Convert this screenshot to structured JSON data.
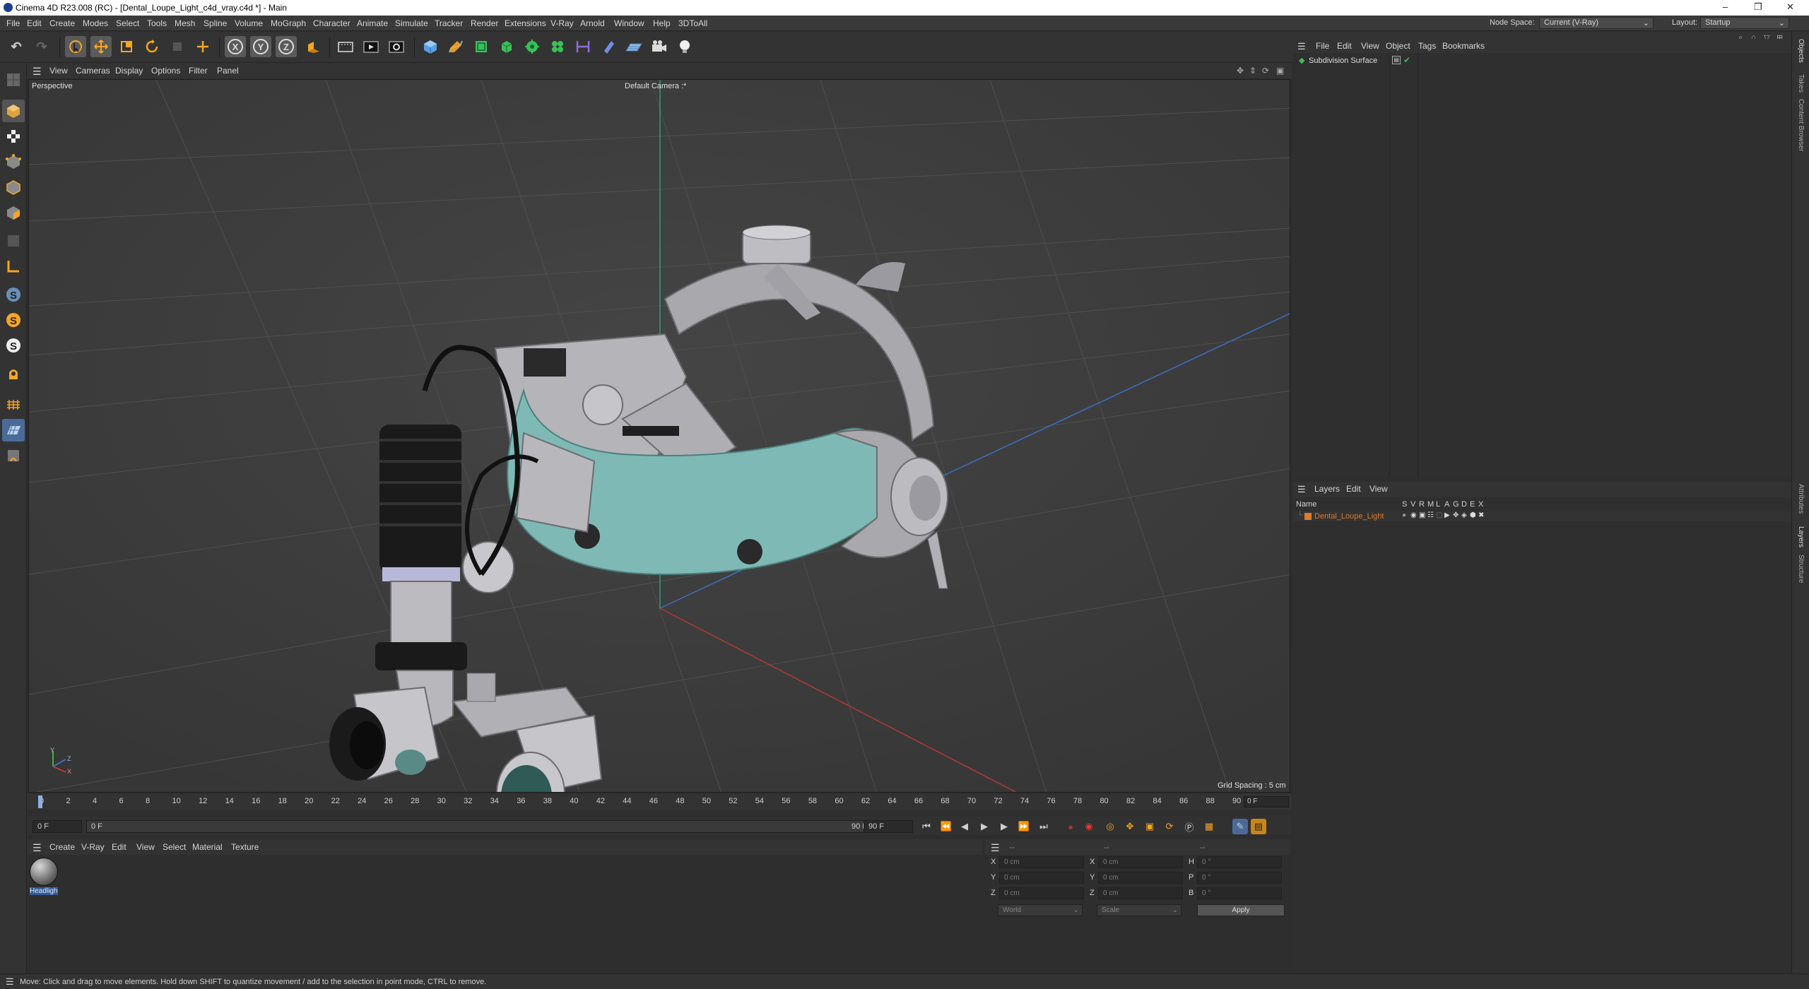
{
  "window": {
    "title": "Cinema 4D R23.008 (RC) - [Dental_Loupe_Light_c4d_vray.c4d *] - Main",
    "controls": [
      "–",
      "❐",
      "✕"
    ]
  },
  "menubar": {
    "items": [
      "File",
      "Edit",
      "Create",
      "Modes",
      "Select",
      "Tools",
      "Mesh",
      "Spline",
      "Volume",
      "MoGraph",
      "Character",
      "Animate",
      "Simulate",
      "Tracker",
      "Render",
      "Extensions",
      "V-Ray",
      "Arnold",
      "Window",
      "Help",
      "3DToAll"
    ],
    "node_space_label": "Node Space:",
    "node_space_value": "Current (V-Ray)",
    "layout_label": "Layout:",
    "layout_value": "Startup"
  },
  "toolbar": {
    "axis_x": "X",
    "axis_y": "Y",
    "axis_z": "Z"
  },
  "viewport": {
    "menu": [
      "View",
      "Cameras",
      "Display",
      "Options",
      "Filter",
      "Panel"
    ],
    "view_name": "Perspective",
    "camera": "Default Camera :*",
    "grid_spacing": "Grid Spacing : 5 cm",
    "axis_labels": [
      "Y",
      "Z",
      "X"
    ]
  },
  "timeline": {
    "ticks": [
      "0",
      "2",
      "4",
      "6",
      "8",
      "10",
      "12",
      "14",
      "16",
      "18",
      "20",
      "22",
      "24",
      "26",
      "28",
      "30",
      "32",
      "34",
      "36",
      "38",
      "40",
      "42",
      "44",
      "46",
      "48",
      "50",
      "52",
      "54",
      "56",
      "58",
      "60",
      "62",
      "64",
      "66",
      "68",
      "70",
      "72",
      "74",
      "76",
      "78",
      "80",
      "82",
      "84",
      "86",
      "88",
      "90"
    ],
    "current_frame_right": "0 F",
    "start_field": "0 F",
    "preview_start": "0 F",
    "preview_end": "90 F",
    "end_field": "90 F"
  },
  "material_manager": {
    "menu": [
      "Create",
      "V-Ray",
      "Edit",
      "View",
      "Select",
      "Material",
      "Texture"
    ],
    "materials": [
      {
        "name": "Headligh"
      }
    ]
  },
  "coordinates": {
    "header": [
      "--",
      "--",
      "--"
    ],
    "rows": [
      {
        "a": "X",
        "a_val": "0 cm",
        "b": "X",
        "b_val": "0 cm",
        "c": "H",
        "c_val": "0 °"
      },
      {
        "a": "Y",
        "a_val": "0 cm",
        "b": "Y",
        "b_val": "0 cm",
        "c": "P",
        "c_val": "0 °"
      },
      {
        "a": "Z",
        "a_val": "0 cm",
        "b": "Z",
        "b_val": "0 cm",
        "c": "B",
        "c_val": "0 °"
      }
    ],
    "space": "World",
    "mode": "Scale",
    "apply": "Apply"
  },
  "object_manager": {
    "menu": [
      "File",
      "Edit",
      "View",
      "Object",
      "Tags",
      "Bookmarks"
    ],
    "objects": [
      {
        "name": "Subdivision Surface"
      }
    ]
  },
  "layer_manager": {
    "menu": [
      "Layers",
      "Edit",
      "View"
    ],
    "columns": [
      "Name",
      "S",
      "V",
      "R",
      "M",
      "L",
      "A",
      "G",
      "D",
      "E",
      "X"
    ],
    "layers": [
      {
        "name": "Dental_Loupe_Light",
        "color": "#e07a2e"
      }
    ]
  },
  "side_tabs": {
    "top": [
      "Objects",
      "Takes",
      "Content Browser"
    ],
    "bottom": [
      "Attributes",
      "Layers",
      "Structure"
    ]
  },
  "status": {
    "text": "Move: Click and drag to move elements. Hold down SHIFT to quantize movement / add to the selection in point mode, CTRL to remove."
  },
  "colors": {
    "accent_orange": "#f5a623",
    "x_axis": "#c0392b",
    "y_axis": "#2ecc71",
    "z_axis": "#3b6fc4",
    "headband_teal": "#7fb9b5"
  }
}
